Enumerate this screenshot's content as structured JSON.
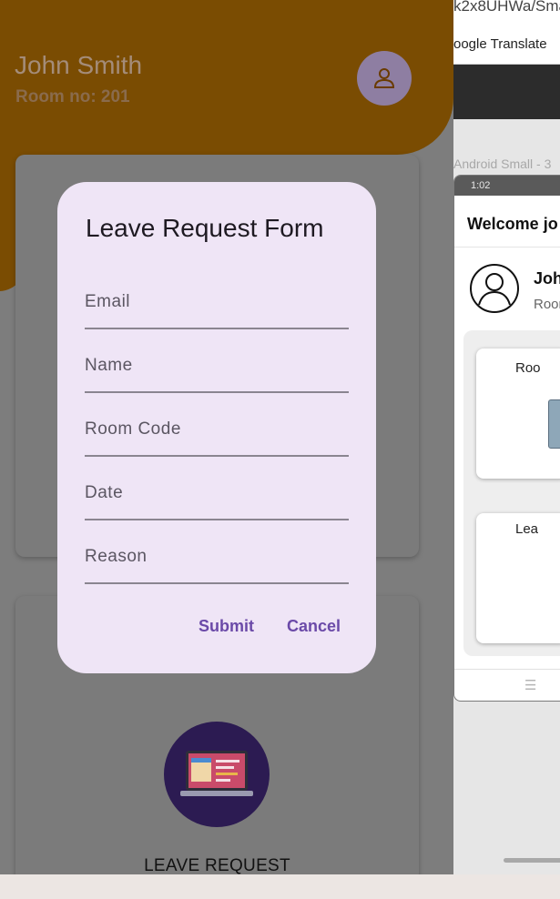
{
  "app": {
    "user_name": "John Smith",
    "room_no": "Room no: 201",
    "profile_icon": "person-icon",
    "cards": [
      {
        "label": "",
        "icon": "room-illustration"
      },
      {
        "label": "LEAVE REQUEST",
        "icon": "laptop-calendar-illustration"
      }
    ],
    "colors": {
      "header": "#7a4c02",
      "overlay_bg": "#7d7d7d",
      "avatar_bg": "#8e7ea2"
    }
  },
  "dialog": {
    "title": "Leave Request Form",
    "fields": [
      {
        "placeholder": "Email",
        "value": ""
      },
      {
        "placeholder": "Name",
        "value": ""
      },
      {
        "placeholder": "Room Code",
        "value": ""
      },
      {
        "placeholder": "Date",
        "value": ""
      },
      {
        "placeholder": "Reason",
        "value": ""
      }
    ],
    "submit_label": "Submit",
    "cancel_label": "Cancel",
    "colors": {
      "background": "#efe5f6",
      "action": "#6b4aa8"
    }
  },
  "side_panel": {
    "url_fragment": "k2x8UHWa/Sma",
    "bookmark": "oogle Translate",
    "frame_label": "Android Small - 3",
    "preview": {
      "time": "1:02",
      "welcome": "Welcome jo",
      "name": "Joh",
      "room": "Roon",
      "card_labels": [
        "Roo",
        "Lea"
      ],
      "menu_icon": "menu-icon"
    }
  }
}
